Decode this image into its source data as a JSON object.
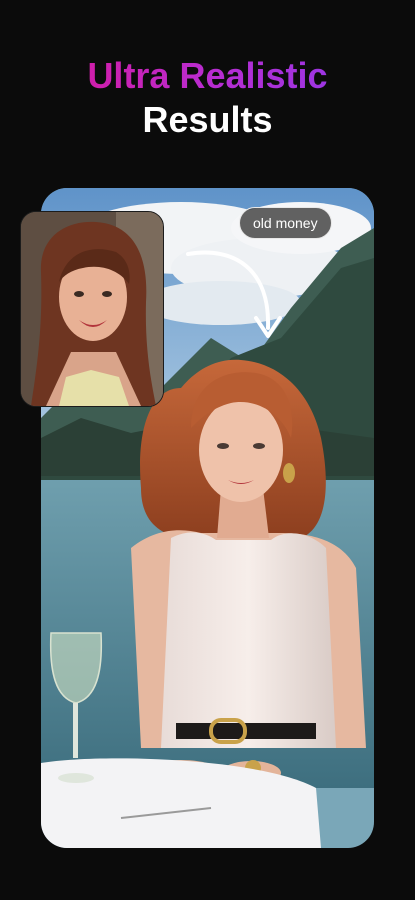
{
  "headline": {
    "line1": "Ultra Realistic",
    "line2": "Results"
  },
  "style_tag": "old money",
  "colors": {
    "background": "#0b0b0b",
    "gradient_start": "#e0148f",
    "gradient_end": "#8a3cf0",
    "headline_white": "#ffffff"
  },
  "icons": {
    "transform_arrow": "curved-arrow-icon"
  }
}
